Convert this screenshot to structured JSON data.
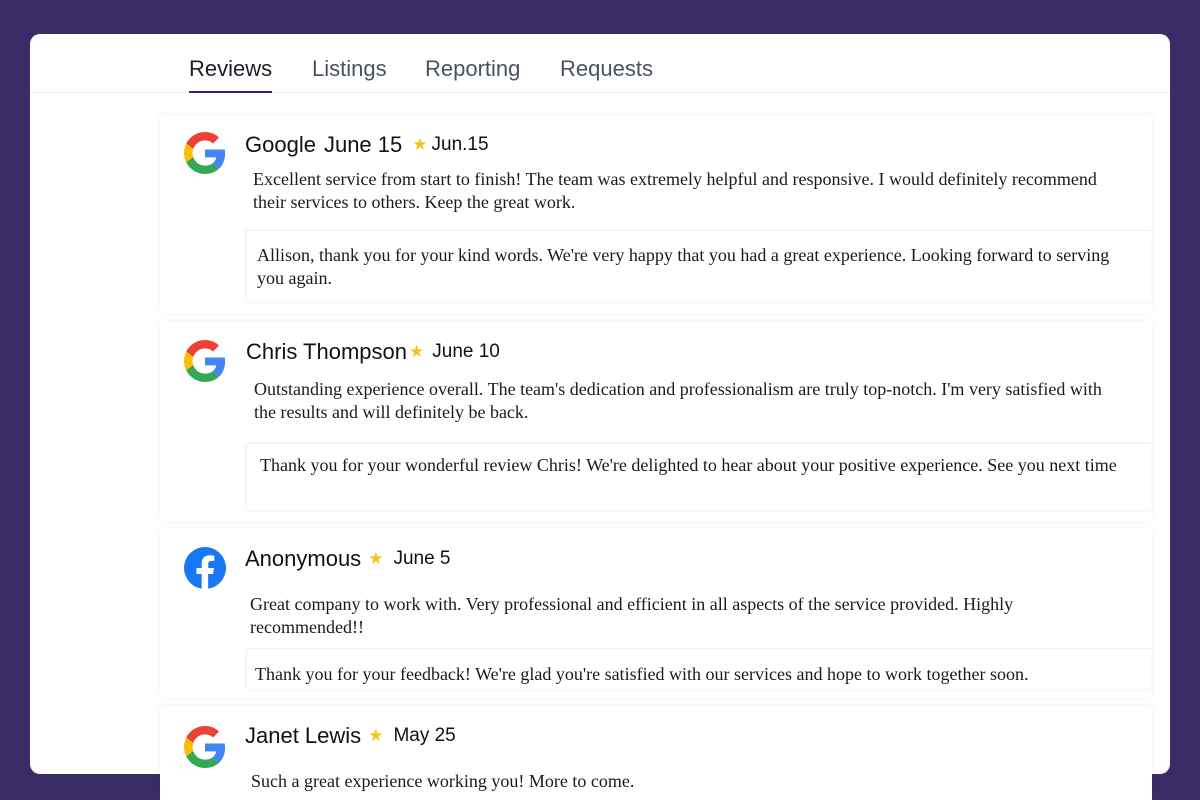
{
  "tabs": [
    {
      "label": "Reviews",
      "active": true
    },
    {
      "label": "Listings",
      "active": false
    },
    {
      "label": "Reporting",
      "active": false
    },
    {
      "label": "Requests",
      "active": false
    }
  ],
  "colors": {
    "background": "#3a2c66",
    "panel": "#ffffff",
    "tab_underline": "#2c2a72",
    "star": "#f5c518",
    "facebook": "#1877f2"
  },
  "reviews": [
    {
      "platform_icon": "google-icon",
      "reviewer": "Google",
      "date_primary": "June 15",
      "date": "Jun.15",
      "text": "Excellent service from start to finish! The team was extremely helpful and responsive. I would definitely recommend their services to others. Keep the great work.",
      "reply": "Allison, thank you for your kind words. We're very happy that you had a great experience. Looking forward to serving you again."
    },
    {
      "platform_icon": "google-icon",
      "reviewer": "Chris Thompson",
      "date": "June 10",
      "text": "Outstanding experience overall. The team's dedication and professionalism are truly top-notch. I'm very satisfied with the results and will definitely be back.",
      "reply": "Thank you for your wonderful review Chris! We're delighted to hear about your positive experience. See you next time"
    },
    {
      "platform_icon": "facebook-icon",
      "reviewer": "Anonymous",
      "date": "June 5",
      "text": "Great company to work with. Very professional and efficient in all aspects of the service provided. Highly recommended!!",
      "reply": "Thank you for your feedback! We're glad you're satisfied with our services and hope to work together soon."
    },
    {
      "platform_icon": "google-icon",
      "reviewer": "Janet Lewis",
      "date": "May 25",
      "text": "Such a great experience working you! More to come."
    }
  ]
}
